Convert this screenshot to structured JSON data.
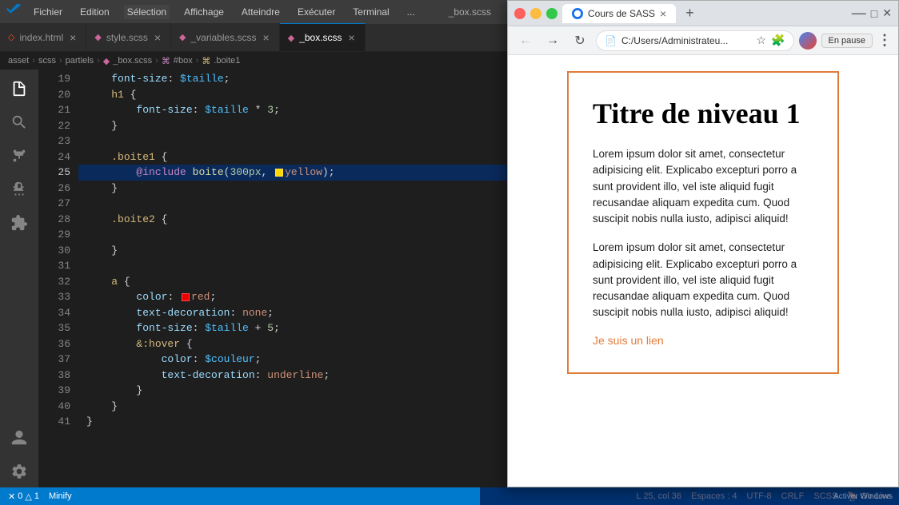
{
  "titleBar": {
    "logo": "✕",
    "menus": [
      "Fichier",
      "Edition",
      "Sélection",
      "Affichage",
      "Atteindre",
      "Exécuter",
      "Terminal",
      "..."
    ],
    "windowTitle": "_box.scss"
  },
  "tabs": [
    {
      "id": "index-html",
      "icon": "◇",
      "label": "index.html",
      "active": false,
      "modified": false
    },
    {
      "id": "style-scss",
      "icon": "◆",
      "label": "style.scss",
      "active": false,
      "modified": false
    },
    {
      "id": "variables-scss",
      "icon": "◆",
      "label": "_variables.scss",
      "active": false,
      "modified": false
    },
    {
      "id": "box-scss",
      "icon": "◆",
      "label": "_box.scss",
      "active": true,
      "modified": false
    }
  ],
  "breadcrumb": [
    "asset",
    "scss",
    "partiels",
    "_box.scss",
    "#box",
    ".boite1"
  ],
  "codeLines": [
    {
      "num": 19,
      "content": "    font-size: $taille;"
    },
    {
      "num": 20,
      "content": "    h1 {"
    },
    {
      "num": 21,
      "content": "        font-size: $taille * 3;"
    },
    {
      "num": 22,
      "content": "    }"
    },
    {
      "num": 23,
      "content": ""
    },
    {
      "num": 24,
      "content": "    .boite1 {"
    },
    {
      "num": 25,
      "content": "        @include boite(300px, yellow);",
      "active": true
    },
    {
      "num": 26,
      "content": "    }"
    },
    {
      "num": 27,
      "content": ""
    },
    {
      "num": 28,
      "content": "    .boite2 {"
    },
    {
      "num": 29,
      "content": ""
    },
    {
      "num": 30,
      "content": "    }"
    },
    {
      "num": 31,
      "content": ""
    },
    {
      "num": 32,
      "content": "    a {"
    },
    {
      "num": 33,
      "content": "        color: red;"
    },
    {
      "num": 34,
      "content": "        text-decoration: none;"
    },
    {
      "num": 35,
      "content": "        font-size: $taille + 5;"
    },
    {
      "num": 36,
      "content": "        &:hover {"
    },
    {
      "num": 37,
      "content": "            color: $couleur;"
    },
    {
      "num": 38,
      "content": "            text-decoration: underline;"
    },
    {
      "num": 39,
      "content": "        }"
    },
    {
      "num": 40,
      "content": "    }"
    },
    {
      "num": 41,
      "content": "}"
    }
  ],
  "statusBar": {
    "errors": "0",
    "warnings": "1",
    "minify": "Minify",
    "position": "L 25, col 36",
    "spaces": "Espaces : 4",
    "encoding": "UTF-8",
    "lineEnding": "CRLF",
    "language": "SCSS",
    "liveServer": "Go Live",
    "activateWindows": "Activer Windows"
  },
  "browser": {
    "tabTitle": "Cours de SASS",
    "url": "C:/Users/Administrateu...",
    "pauseBtn": "En pause",
    "demoTitle": "Titre de niveau 1",
    "demoPara1": "Lorem ipsum dolor sit amet, consectetur adipisicing elit. Explicabo excepturi porro a sunt provident illo, vel iste aliquid fugit recusandae aliquam expedita cum. Quod suscipit nobis nulla iusto, adipisci aliquid!",
    "demoPara2": "Lorem ipsum dolor sit amet, consectetur adipisicing elit. Explicabo excepturi porro a sunt provident illo, vel iste aliquid fugit recusandae aliquam expedita cum. Quod suscipit nobis nulla iusto, adipisci aliquid!",
    "demoLink": "Je suis un lien"
  },
  "activityBar": {
    "icons": [
      "explorer",
      "search",
      "git",
      "debug",
      "extensions",
      "account",
      "settings"
    ]
  }
}
